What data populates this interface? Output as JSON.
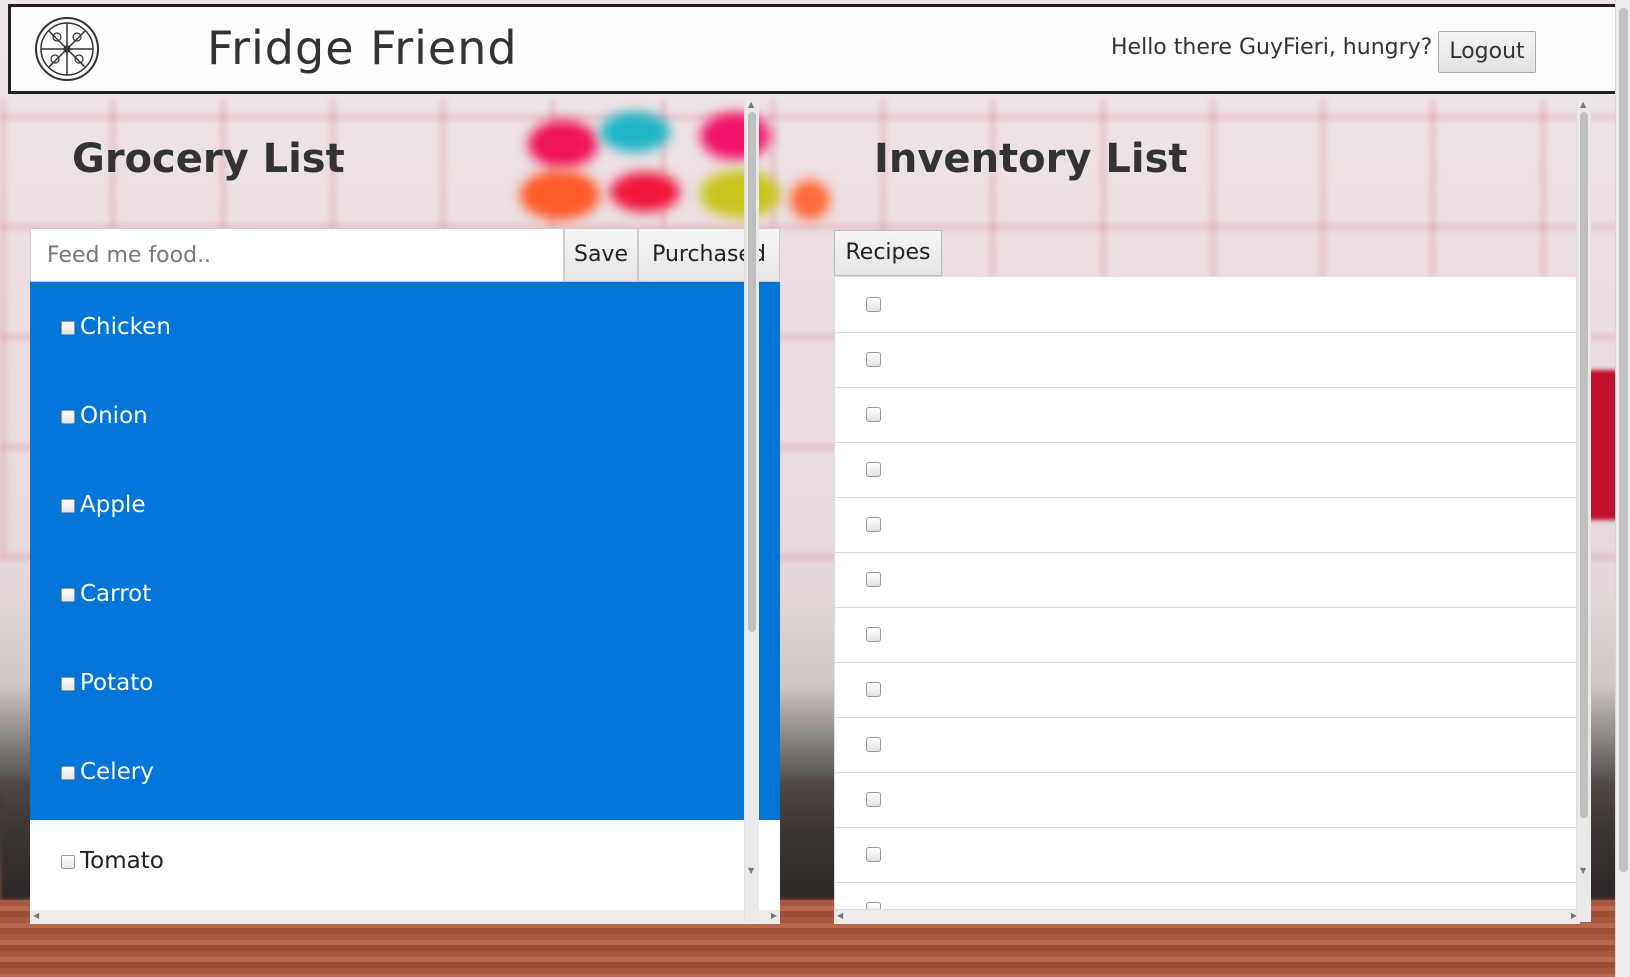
{
  "header": {
    "title": "Fridge Friend",
    "greeting": "Hello there GuyFieri, hungry?",
    "logout_label": "Logout",
    "logo_icon": "pizza-icon"
  },
  "grocery": {
    "title": "Grocery List",
    "input_placeholder": "Feed me food..",
    "input_value": "",
    "save_label": "Save",
    "purchased_label": "Purchased",
    "selected_color": "#0275d8",
    "items": [
      {
        "label": "Chicken",
        "selected": true
      },
      {
        "label": "Onion",
        "selected": true
      },
      {
        "label": "Apple",
        "selected": true
      },
      {
        "label": "Carrot",
        "selected": true
      },
      {
        "label": "Potato",
        "selected": true
      },
      {
        "label": "Celery",
        "selected": true
      },
      {
        "label": "Tomato",
        "selected": false
      }
    ]
  },
  "inventory": {
    "title": "Inventory List",
    "recipes_label": "Recipes",
    "items": [
      "",
      "",
      "",
      "",
      "",
      "",
      "",
      "",
      "",
      "",
      "",
      ""
    ]
  }
}
